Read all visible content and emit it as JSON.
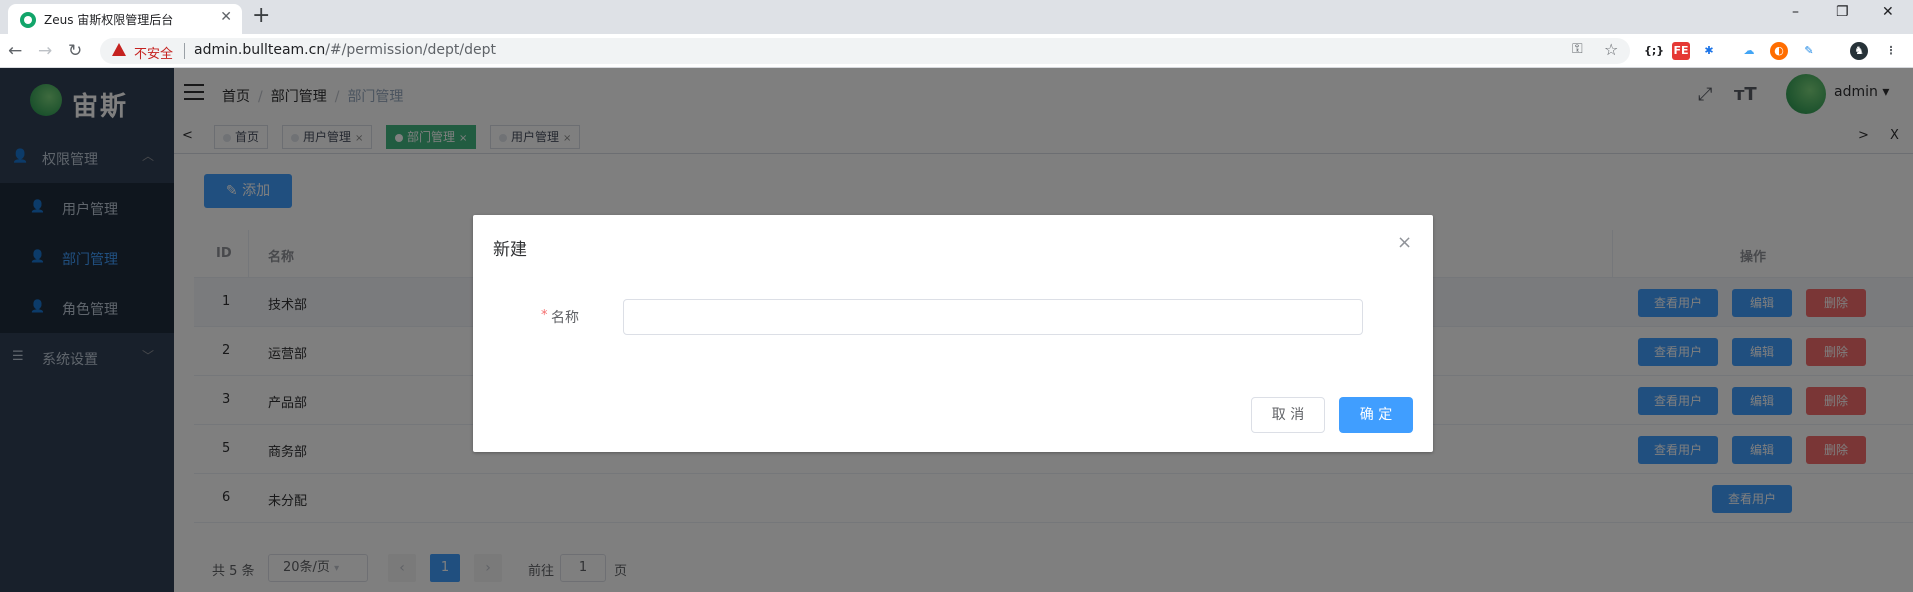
{
  "browser": {
    "tab_title": "Zeus 宙斯权限管理后台",
    "tab_close": "✕",
    "new_tab": "+",
    "security_warning": "不安全",
    "url_host": "admin.bullteam.cn",
    "url_path": "/#/permission/dept/dept",
    "window_controls": [
      "–",
      "❐",
      "✕"
    ],
    "extensions": [
      "{;}",
      "FE",
      "✱",
      "☁",
      "◐",
      "✎",
      "♞",
      "⋮"
    ]
  },
  "sidebar": {
    "logo_text": "宙斯",
    "groups": [
      {
        "label": "权限管理",
        "icon": "user-group-icon",
        "expanded": true,
        "items": [
          {
            "label": "用户管理",
            "active": false
          },
          {
            "label": "部门管理",
            "active": true
          },
          {
            "label": "角色管理",
            "active": false
          }
        ]
      },
      {
        "label": "系统设置",
        "icon": "settings-list-icon",
        "expanded": false
      }
    ]
  },
  "navbar": {
    "breadcrumb": [
      "首页",
      "部门管理",
      "部门管理"
    ],
    "breadcrumb_sep": "/",
    "username": "admin",
    "user_caret": "▾"
  },
  "tags_view": {
    "left_arrow": "<",
    "right_arrow": ">",
    "close_all": "X",
    "tags": [
      {
        "label": "首页",
        "active": false,
        "closable": false
      },
      {
        "label": "用户管理",
        "active": false,
        "closable": true
      },
      {
        "label": "部门管理",
        "active": true,
        "closable": true
      },
      {
        "label": "用户管理",
        "active": false,
        "closable": true
      }
    ],
    "close_glyph": "×"
  },
  "page": {
    "add_button": "添加",
    "table": {
      "headers": {
        "id": "ID",
        "name": "名称",
        "ops": "操作"
      },
      "rows": [
        {
          "id": "1",
          "name": "技术部",
          "highlighted": true,
          "ops": [
            "查看用户",
            "编辑",
            "删除"
          ]
        },
        {
          "id": "2",
          "name": "运营部",
          "highlighted": false,
          "ops": [
            "查看用户",
            "编辑",
            "删除"
          ]
        },
        {
          "id": "3",
          "name": "产品部",
          "highlighted": false,
          "ops": [
            "查看用户",
            "编辑",
            "删除"
          ]
        },
        {
          "id": "5",
          "name": "商务部",
          "highlighted": false,
          "ops": [
            "查看用户",
            "编辑",
            "删除"
          ]
        },
        {
          "id": "6",
          "name": "未分配",
          "highlighted": false,
          "ops": [
            "查看用户"
          ]
        }
      ]
    },
    "pagination": {
      "total_text": "共 5 条",
      "page_size": "20条/页",
      "current_page": "1",
      "goto_label": "前往",
      "goto_value": "1",
      "page_suffix": "页"
    }
  },
  "dialog": {
    "title": "新建",
    "close": "×",
    "required_mark": "*",
    "field_label": "名称",
    "field_value": "",
    "field_placeholder": "",
    "cancel_label": "取 消",
    "confirm_label": "确 定"
  },
  "colors": {
    "primary": "#409eff",
    "danger": "#f56c6c",
    "tag_active": "#42b983",
    "sidebar_bg": "#304156",
    "mask": "rgba(0,0,0,0.5)"
  }
}
